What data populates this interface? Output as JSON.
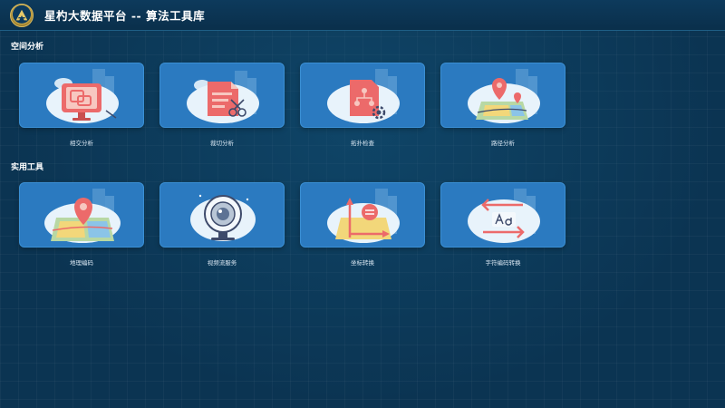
{
  "header": {
    "title": "星杓大数据平台 -- 算法工具库"
  },
  "sections": [
    {
      "title": "空间分析",
      "tools": [
        {
          "label": "相交分析",
          "icon": "intersect-analysis-icon"
        },
        {
          "label": "裁切分析",
          "icon": "clip-analysis-icon"
        },
        {
          "label": "拓扑检查",
          "icon": "topology-check-icon"
        },
        {
          "label": "路径分析",
          "icon": "route-analysis-icon"
        }
      ]
    },
    {
      "title": "实用工具",
      "tools": [
        {
          "label": "地理编码",
          "icon": "geocoding-icon"
        },
        {
          "label": "视频流服务",
          "icon": "video-stream-icon"
        },
        {
          "label": "坐标转换",
          "icon": "coordinate-transform-icon"
        },
        {
          "label": "字符编码转换",
          "icon": "char-encoding-icon"
        }
      ]
    }
  ],
  "colors": {
    "background": "#0b3452",
    "card": "#2b7ac0",
    "accent_red": "#ec6a6a",
    "cloud": "#e8f3fb"
  }
}
